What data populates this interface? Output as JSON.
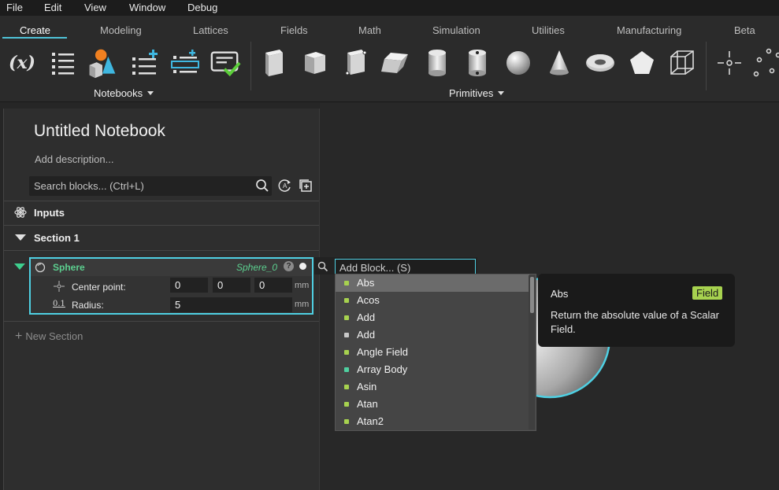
{
  "menu": [
    "File",
    "Edit",
    "View",
    "Window",
    "Debug"
  ],
  "tabs": [
    "Create",
    "Modeling",
    "Lattices",
    "Fields",
    "Math",
    "Simulation",
    "Utilities",
    "Manufacturing",
    "Beta"
  ],
  "active_tab": "Create",
  "ribbon": {
    "group_notebooks": "Notebooks",
    "group_primitives": "Primitives",
    "variable_icon_text": "(x)"
  },
  "notebook": {
    "title": "Untitled Notebook",
    "description_placeholder": "Add description...",
    "search_placeholder": "Search blocks... (Ctrl+L)"
  },
  "inputs_label": "Inputs",
  "section1_label": "Section 1",
  "sphere": {
    "name": "Sphere",
    "var_name": "Sphere_0",
    "help": "?",
    "center_label": "Center point:",
    "center_x": "0",
    "center_y": "0",
    "center_z": "0",
    "radius_label": "Radius:",
    "radius_icon_text": "0.1",
    "radius_value": "5",
    "unit": "mm"
  },
  "new_section": "New Section",
  "add_block_placeholder": "Add Block... (S)",
  "dropdown_items": [
    {
      "label": "Abs",
      "color": "#a7d24f"
    },
    {
      "label": "Acos",
      "color": "#a7d24f"
    },
    {
      "label": "Add",
      "color": "#a7d24f"
    },
    {
      "label": "Add",
      "color": "#c8c8c8"
    },
    {
      "label": "Angle Field",
      "color": "#a7d24f"
    },
    {
      "label": "Array Body",
      "color": "#4fd0a0"
    },
    {
      "label": "Asin",
      "color": "#a7d24f"
    },
    {
      "label": "Atan",
      "color": "#a7d24f"
    },
    {
      "label": "Atan2",
      "color": "#a7d24f"
    }
  ],
  "tooltip": {
    "title": "Abs",
    "badge": "Field",
    "description": "Return the absolute value of a Scalar Field."
  },
  "colors": {
    "accent": "#4fd0e3",
    "field_badge": "#a7d24f",
    "tab_underline": "#4fc3d8"
  }
}
